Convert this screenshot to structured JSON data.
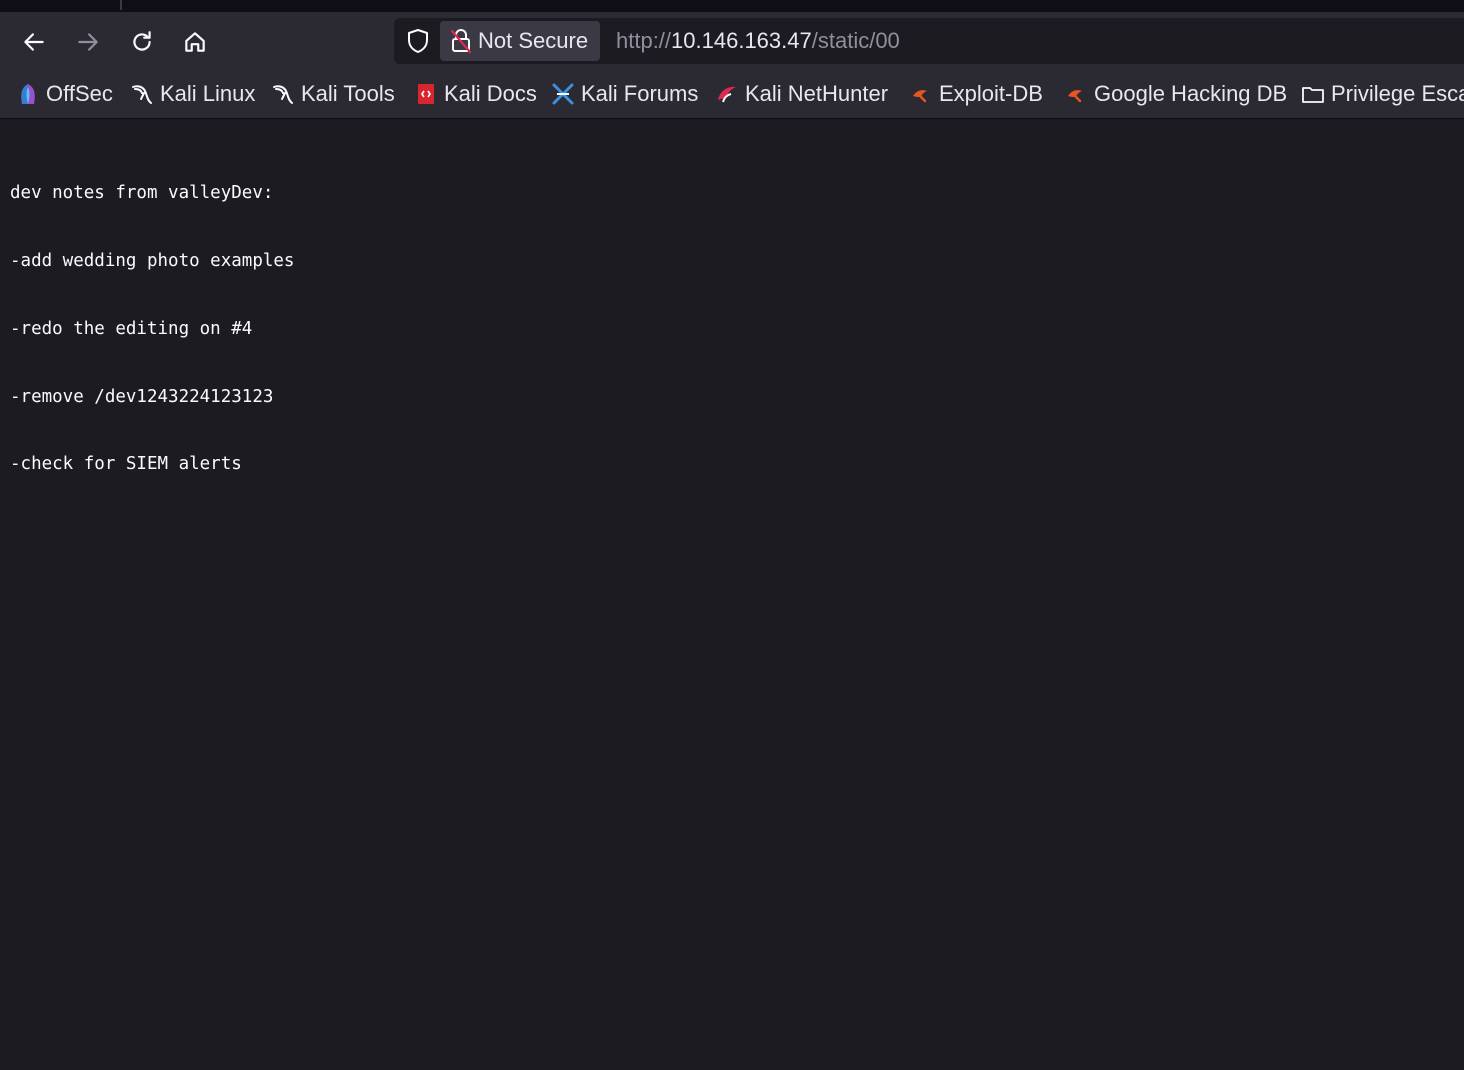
{
  "browser": {
    "security_label": "Not Secure",
    "url": {
      "scheme": "http://",
      "host": "10.146.163.47",
      "path": "/static/00"
    },
    "nav": {
      "back_icon": "arrow-left-icon",
      "forward_icon": "arrow-right-icon",
      "reload_icon": "reload-icon",
      "home_icon": "home-icon"
    }
  },
  "bookmarks": [
    {
      "label": "OffSec",
      "icon": "offsec-icon"
    },
    {
      "label": "Kali Linux",
      "icon": "kali-dragon-icon"
    },
    {
      "label": "Kali Tools",
      "icon": "kali-dragon-icon"
    },
    {
      "label": "Kali Docs",
      "icon": "kali-docs-icon"
    },
    {
      "label": "Kali Forums",
      "icon": "kali-forums-icon"
    },
    {
      "label": "Kali NetHunter",
      "icon": "nethunter-icon"
    },
    {
      "label": "Exploit-DB",
      "icon": "exploitdb-icon"
    },
    {
      "label": "Google Hacking DB",
      "icon": "exploitdb-icon"
    },
    {
      "label": "Privilege Esca",
      "icon": "folder-icon"
    }
  ],
  "page": {
    "lines": [
      "dev notes from valleyDev:",
      "-add wedding photo examples",
      "-redo the editing on #4",
      "-remove /dev1243224123123",
      "-check for SIEM alerts"
    ]
  },
  "colors": {
    "toolbar": "#2b2a33",
    "content_bg": "#1c1b22",
    "text": "#fbfbfe",
    "exploitdb_orange": "#e8561d"
  }
}
